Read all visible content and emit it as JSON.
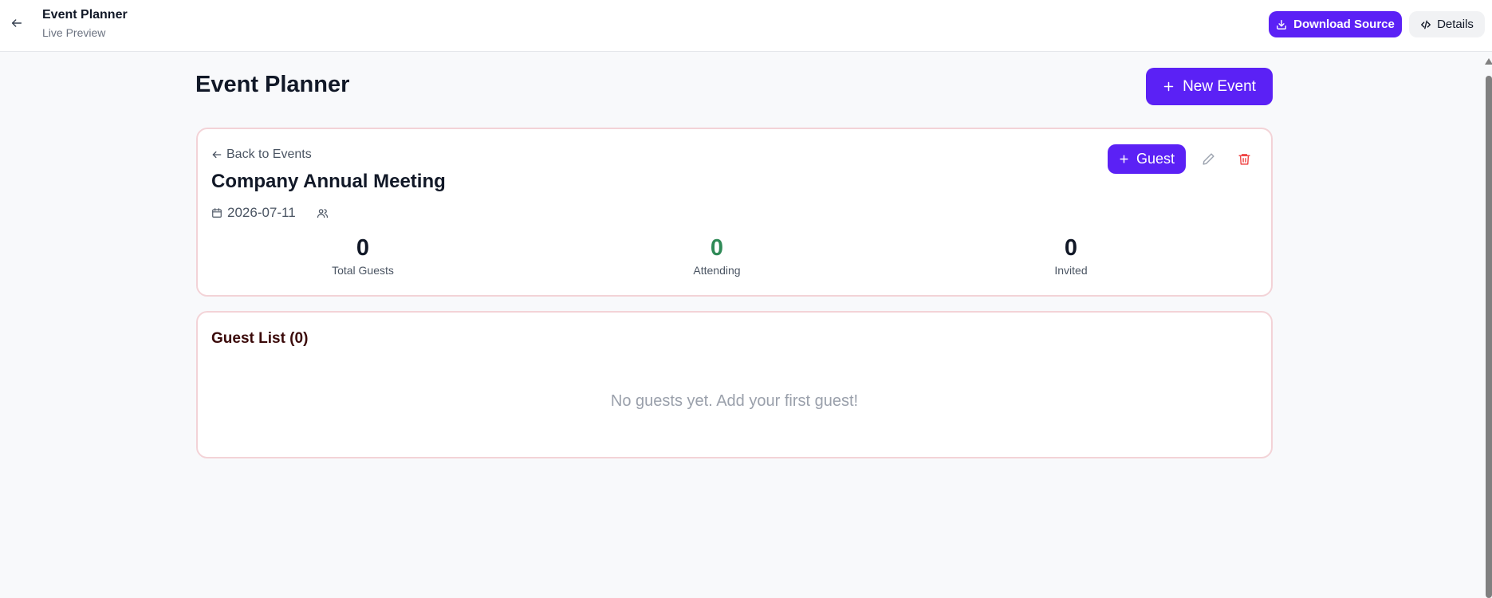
{
  "topbar": {
    "title": "Event Planner",
    "subtitle": "Live Preview",
    "download_label": "Download Source",
    "details_label": "Details"
  },
  "page": {
    "title": "Event Planner",
    "new_event_label": "New Event"
  },
  "event": {
    "back_label": "Back to Events",
    "name": "Company Annual Meeting",
    "date": "2026-07-11",
    "add_guest_label": "Guest",
    "stats": [
      {
        "value": "0",
        "label": "Total Guests"
      },
      {
        "value": "0",
        "label": "Attending"
      },
      {
        "value": "0",
        "label": "Invited"
      }
    ]
  },
  "guests": {
    "title": "Guest List (0)",
    "empty_message": "No guests yet. Add your first guest!"
  },
  "colors": {
    "primary": "#5b21f5",
    "attending": "#2f8a57",
    "danger": "#ef4444",
    "card_border": "#f3d3d7"
  },
  "icons": [
    "arrow-left-icon",
    "download-icon",
    "code-icon",
    "plus-icon",
    "calendar-icon",
    "users-icon",
    "pencil-icon",
    "trash-icon"
  ]
}
